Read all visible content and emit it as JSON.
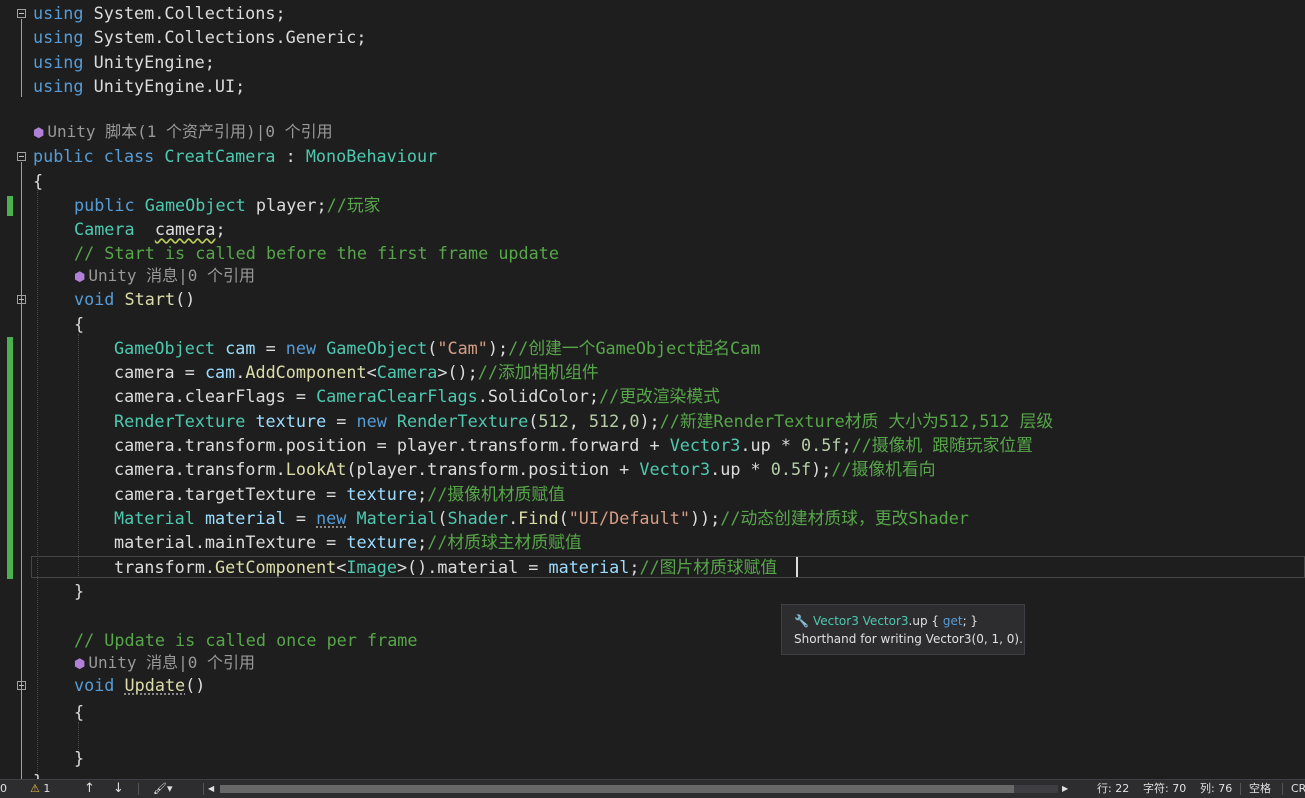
{
  "code": {
    "l1": [
      "using",
      " System.Collections;"
    ],
    "l2": [
      "using",
      " System.Collections.Generic;"
    ],
    "l3": [
      "using",
      " UnityEngine;"
    ],
    "l4": [
      "using",
      " UnityEngine.UI;"
    ],
    "lens_class": "Unity 脚本(1 个资产引用)|0 个引用",
    "l6": [
      "public",
      " ",
      "class",
      " ",
      "CreatCamera",
      " : ",
      "MonoBehaviour"
    ],
    "l7": "{",
    "l8": [
      "public",
      " ",
      "GameObject",
      " player;",
      "//玩家"
    ],
    "l9": [
      "Camera",
      "  ",
      "camera",
      ";"
    ],
    "l10": "// Start is called before the first frame update",
    "lens_start": "Unity 消息|0 个引用",
    "l12": [
      "void",
      " ",
      "Start",
      "()"
    ],
    "l13": "{",
    "l14": [
      "GameObject",
      " ",
      "cam",
      " = ",
      "new",
      " ",
      "GameObject",
      "(",
      "\"Cam\"",
      ");",
      "//创建一个GameObject起名Cam"
    ],
    "l15": [
      "camera",
      " = ",
      "cam",
      ".",
      "AddComponent",
      "<",
      "Camera",
      ">();",
      "//添加相机组件"
    ],
    "l16": [
      "camera.clearFlags = ",
      "CameraClearFlags",
      ".SolidColor;",
      "//更改渲染模式"
    ],
    "l17": [
      "RenderTexture",
      " ",
      "texture",
      " = ",
      "new",
      " ",
      "RenderTexture",
      "(",
      "512",
      ", ",
      "512",
      ",",
      "0",
      ");",
      "//新建RenderTexture材质 大小为512,512 层级"
    ],
    "l18": [
      "camera.transform.position = player.transform.forward + ",
      "Vector3",
      ".up * ",
      "0.5f",
      ";",
      "//摄像机 跟随玩家位置"
    ],
    "l19": [
      "camera.transform.",
      "LookAt",
      "(player.transform.position + ",
      "Vector3",
      ".up * ",
      "0.5f",
      ");",
      "//摄像机看向"
    ],
    "l20": [
      "camera.targetTexture = ",
      "texture",
      ";",
      "//摄像机材质赋值"
    ],
    "l21": [
      "Material",
      " ",
      "material",
      " = ",
      "new",
      " ",
      "Material",
      "(",
      "Shader",
      ".",
      "Find",
      "(",
      "\"UI/Default\"",
      "));",
      "//动态创建材质球，更改Shader"
    ],
    "l22": [
      "material.mainTexture = ",
      "texture",
      ";",
      "//材质球主材质赋值"
    ],
    "l23": [
      "transform.",
      "GetComponent",
      "<",
      "Image",
      ">().material = ",
      "material",
      ";",
      "//图片材质球赋值"
    ],
    "l24": "}",
    "l26": "// Update is called once per frame",
    "lens_update": "Unity 消息|0 个引用",
    "l28": [
      "void",
      " ",
      "Update",
      "()"
    ],
    "l29": "{",
    "l31": "}",
    "l32": "}"
  },
  "tooltip": {
    "type": "Vector3",
    "member": "Vector3",
    "member_name": ".up",
    "accessor_open": " { ",
    "accessor_kw": "get",
    "accessor_close": "; }",
    "description": "Shorthand for writing Vector3(0, 1, 0)."
  },
  "status": {
    "errors": "0",
    "warnings": "1",
    "line": "行: 22",
    "char": "字符: 70",
    "col": "列: 76",
    "spaces": "空格",
    "eol": "CR"
  },
  "colors": {
    "background": "#1e1e1e",
    "keyword": "#569cd6",
    "type": "#4ec9b0",
    "method": "#dcdcaa",
    "variable": "#9cdcfe",
    "comment": "#57a64a",
    "string": "#d69d85",
    "number": "#b5cea8",
    "modified_bar": "#4caf50"
  }
}
